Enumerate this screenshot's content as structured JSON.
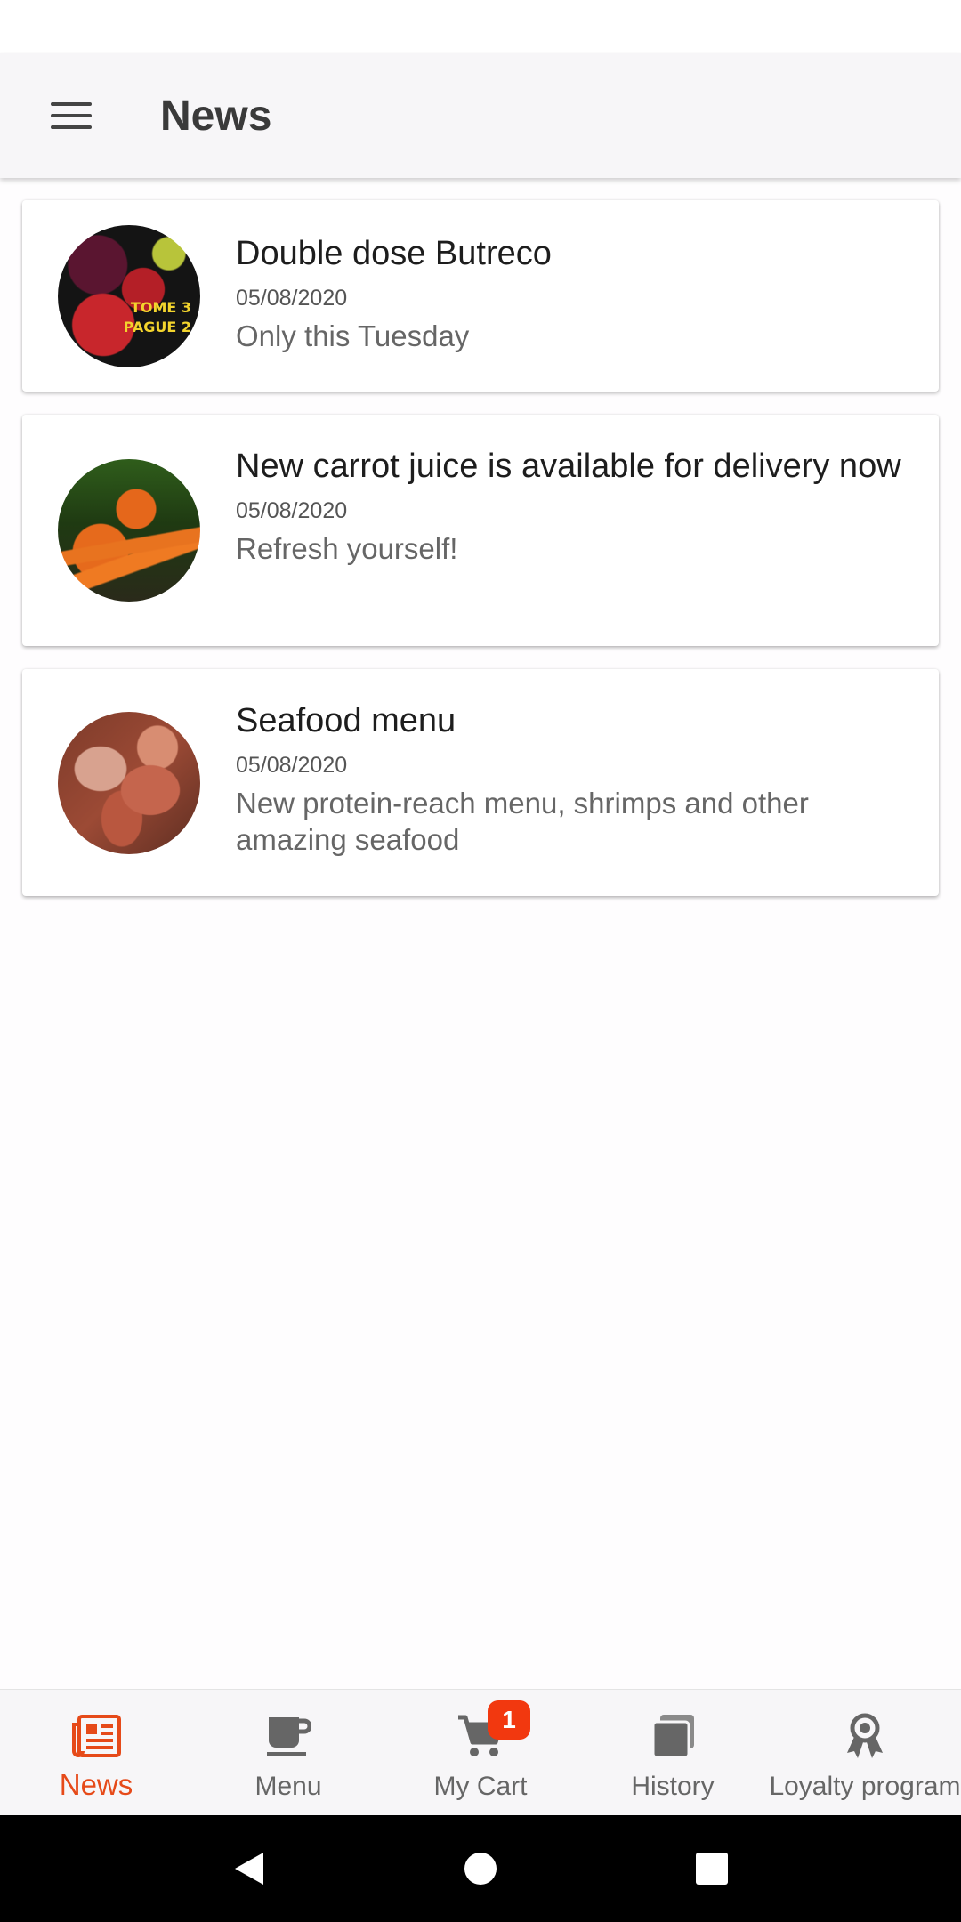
{
  "app_bar": {
    "title": "News"
  },
  "news": [
    {
      "title": "Double dose Butreco",
      "date": "05/08/2020",
      "description": "Only this Tuesday",
      "image_text": "TOME 3\nPAGUE 2"
    },
    {
      "title": "New carrot juice is available for delivery now",
      "date": "05/08/2020",
      "description": "Refresh yourself!"
    },
    {
      "title": "Seafood menu",
      "date": "05/08/2020",
      "description": "New protein-reach menu, shrimps and other amazing seafood"
    }
  ],
  "bottom_nav": {
    "items": [
      {
        "label": "News",
        "icon": "newspaper-icon",
        "active": true
      },
      {
        "label": "Menu",
        "icon": "coffee-cup-icon"
      },
      {
        "label": "My Cart",
        "icon": "cart-icon",
        "badge": "1"
      },
      {
        "label": "History",
        "icon": "history-icon"
      },
      {
        "label": "Loyalty program",
        "icon": "award-ribbon-icon"
      }
    ]
  },
  "colors": {
    "accent": "#e64a19",
    "badge": "#f2380f",
    "icon_inactive": "#666666"
  }
}
